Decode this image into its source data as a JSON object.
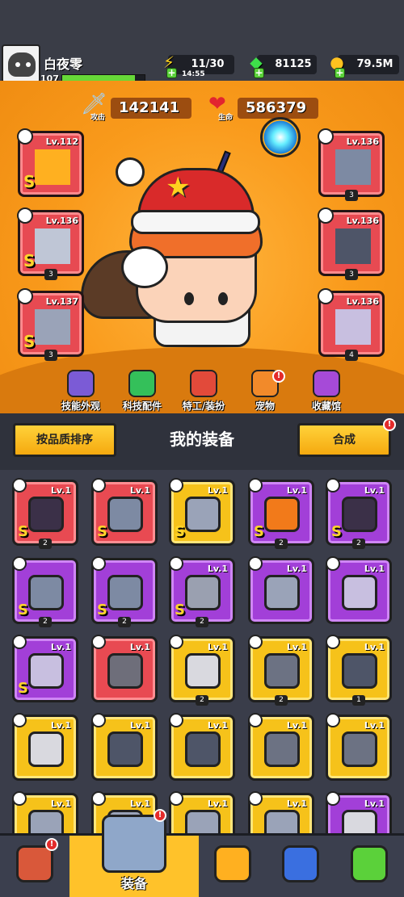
{
  "player": {
    "name": "白夜零",
    "level": "107",
    "xp_fraction": 0.88
  },
  "resources": {
    "energy": {
      "value": "11/30",
      "timer": "14:55"
    },
    "gems": {
      "value": "81125"
    },
    "gold": {
      "value": "79.5M"
    }
  },
  "stats": {
    "attack": {
      "value": "142141",
      "label": "攻击"
    },
    "health": {
      "value": "586379",
      "label": "生命"
    }
  },
  "equipped": {
    "left": [
      {
        "level": "Lv.112",
        "grade": "S",
        "count": "",
        "icon": "gear-staff-icon"
      },
      {
        "level": "Lv.136",
        "grade": "S",
        "count": "3",
        "icon": "star-necklace-icon"
      },
      {
        "level": "Lv.137",
        "grade": "S",
        "count": "3",
        "icon": "gauntlet-icon"
      }
    ],
    "right": [
      {
        "level": "Lv.136",
        "grade": "",
        "count": "3",
        "icon": "armor-icon"
      },
      {
        "level": "Lv.136",
        "grade": "",
        "count": "3",
        "icon": "spiked-belt-icon"
      },
      {
        "level": "Lv.136",
        "grade": "",
        "count": "4",
        "icon": "boots-icon"
      }
    ]
  },
  "menu": [
    {
      "label": "技能外观",
      "icon": "skill-skin-icon"
    },
    {
      "label": "科技配件",
      "icon": "tech-parts-icon"
    },
    {
      "label": "特工/装扮",
      "icon": "agent-costume-icon"
    },
    {
      "label": "宠物",
      "icon": "pet-icon"
    },
    {
      "label": "收藏馆",
      "icon": "collection-icon"
    }
  ],
  "equipment": {
    "sort_label": "按品质排序",
    "title": "我的装备",
    "merge_label": "合成",
    "items": [
      {
        "level": "Lv.1",
        "grade": "S",
        "count": "2",
        "quality": "red",
        "icon": "spiked-staff-icon"
      },
      {
        "level": "Lv.1",
        "grade": "S",
        "count": "",
        "quality": "red",
        "icon": "armor-icon"
      },
      {
        "level": "Lv.1",
        "grade": "S",
        "count": "",
        "quality": "yellow",
        "icon": "gauntlet-icon"
      },
      {
        "level": "Lv.1",
        "grade": "S",
        "count": "2",
        "quality": "purple",
        "icon": "flame-sword-icon"
      },
      {
        "level": "Lv.1",
        "grade": "S",
        "count": "2",
        "quality": "purple",
        "icon": "spiked-staff-icon"
      },
      {
        "level": "",
        "grade": "S",
        "count": "2",
        "quality": "purple",
        "icon": "armor-icon"
      },
      {
        "level": "",
        "grade": "S",
        "count": "2",
        "quality": "purple",
        "icon": "armor-icon"
      },
      {
        "level": "Lv.1",
        "grade": "S",
        "count": "2",
        "quality": "purple",
        "icon": "chain-necklace-icon"
      },
      {
        "level": "Lv.1",
        "grade": "",
        "count": "",
        "quality": "purple",
        "icon": "gauntlet-icon"
      },
      {
        "level": "Lv.1",
        "grade": "",
        "count": "",
        "quality": "purple",
        "icon": "boots-icon"
      },
      {
        "level": "Lv.1",
        "grade": "S",
        "count": "",
        "quality": "purple",
        "icon": "boots-icon"
      },
      {
        "level": "Lv.1",
        "grade": "",
        "count": "",
        "quality": "red",
        "icon": "kunai-icon"
      },
      {
        "level": "Lv.1",
        "grade": "",
        "count": "2",
        "quality": "yellow",
        "icon": "sword-icon"
      },
      {
        "level": "Lv.1",
        "grade": "",
        "count": "2",
        "quality": "yellow",
        "icon": "belt-icon"
      },
      {
        "level": "Lv.1",
        "grade": "",
        "count": "1",
        "quality": "yellow",
        "icon": "spiked-belt-icon"
      },
      {
        "level": "Lv.1",
        "grade": "",
        "count": "",
        "quality": "yellow",
        "icon": "sword-icon"
      },
      {
        "level": "Lv.1",
        "grade": "",
        "count": "",
        "quality": "yellow",
        "icon": "spiked-belt-icon"
      },
      {
        "level": "Lv.1",
        "grade": "",
        "count": "",
        "quality": "yellow",
        "icon": "spiked-belt-icon"
      },
      {
        "level": "Lv.1",
        "grade": "",
        "count": "",
        "quality": "yellow",
        "icon": "belt-icon"
      },
      {
        "level": "Lv.1",
        "grade": "",
        "count": "",
        "quality": "yellow",
        "icon": "belt-icon"
      },
      {
        "level": "Lv.1",
        "grade": "",
        "count": "",
        "quality": "yellow",
        "icon": "gauntlet-icon"
      },
      {
        "level": "Lv.1",
        "grade": "",
        "count": "",
        "quality": "yellow",
        "icon": "gauntlet-icon"
      },
      {
        "level": "Lv.1",
        "grade": "",
        "count": "",
        "quality": "yellow",
        "icon": "gauntlet-icon"
      },
      {
        "level": "Lv.1",
        "grade": "",
        "count": "",
        "quality": "yellow",
        "icon": "gauntlet-icon"
      },
      {
        "level": "Lv.1",
        "grade": "",
        "count": "",
        "quality": "purple",
        "icon": "sword-icon"
      }
    ]
  },
  "nav": [
    {
      "label": "",
      "icon": "shop-icon",
      "active": false
    },
    {
      "label": "装备",
      "icon": "equipment-icon",
      "active": true
    },
    {
      "label": "",
      "icon": "battle-icon",
      "active": false
    },
    {
      "label": "",
      "icon": "talent-icon",
      "active": false
    },
    {
      "label": "",
      "icon": "evolve-icon",
      "active": false
    }
  ],
  "colors": {
    "quality_red": "#e84a52",
    "quality_purple": "#a23fd8",
    "quality_yellow": "#f6c21a",
    "accent": "#ffc22a"
  }
}
